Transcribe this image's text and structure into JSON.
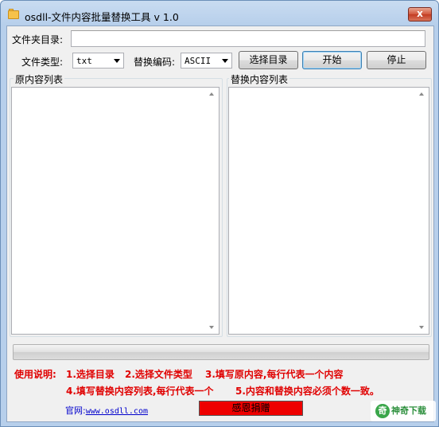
{
  "window": {
    "title": "osdll-文件内容批量替换工具 v 1.0",
    "close_glyph": "x",
    "icon": "folder-icon"
  },
  "form": {
    "folder_label": "文件夹目录:",
    "folder_value": "",
    "filetype_label": "文件类型:",
    "filetype_value": "txt",
    "encoding_label": "替换编码:",
    "encoding_value": "ASCII",
    "select_dir_button": "选择目录",
    "start_button": "开始",
    "stop_button": "停止"
  },
  "lists": {
    "original_title": "原内容列表",
    "replace_title": "替换内容列表"
  },
  "progress": {
    "value": 0
  },
  "instructions": {
    "prefix": "使用说明:",
    "step1": "1.选择目录",
    "step2": "2.选择文件类型",
    "step3": "3.填写原内容,每行代表一个内容",
    "step4": "4.填写替换内容列表,每行代表一个",
    "step5": "5.内容和替换内容必须个数一致。"
  },
  "footer": {
    "website_label": "官网:",
    "website_url": "www.osdll.com",
    "thanks_button": "感恩捐赠"
  },
  "watermark": {
    "text": "神奇下载",
    "logo_glyph": "奇"
  },
  "colors": {
    "accent_red": "#e00000",
    "link_blue": "#0000cc",
    "donate_red": "#ee0000"
  }
}
